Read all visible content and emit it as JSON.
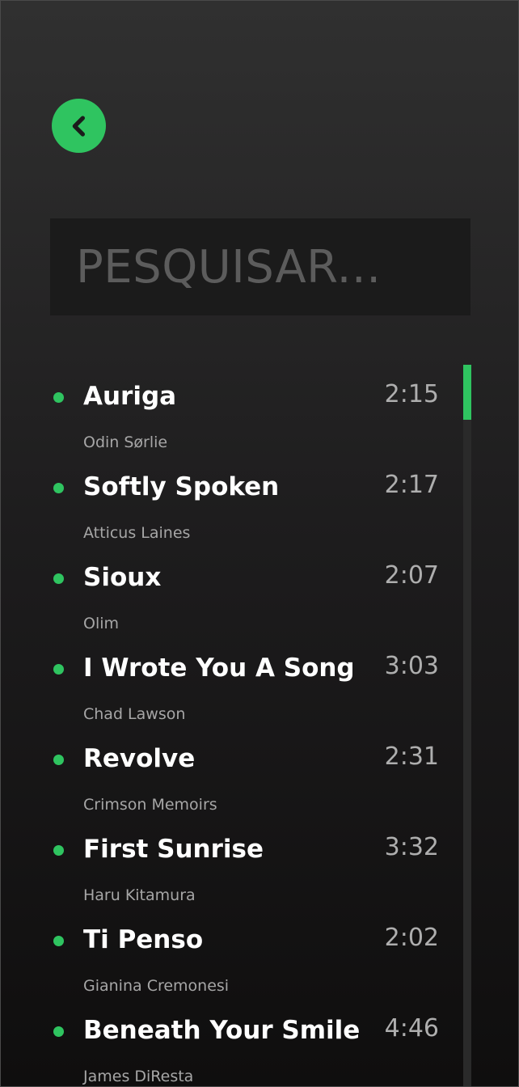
{
  "back_button": {
    "icon": "chevron-left-icon",
    "accent": "#2fc460"
  },
  "search": {
    "placeholder": "PESQUISAR...",
    "value": ""
  },
  "tracks": [
    {
      "title": "Auriga",
      "artist": "Odin Sørlie",
      "duration": "2:15"
    },
    {
      "title": "Softly Spoken",
      "artist": "Atticus Laines",
      "duration": "2:17"
    },
    {
      "title": "Sioux",
      "artist": "Olim",
      "duration": "2:07"
    },
    {
      "title": "I Wrote You A Song",
      "artist": "Chad Lawson",
      "duration": "3:03"
    },
    {
      "title": "Revolve",
      "artist": "Crimson Memoirs",
      "duration": "2:31"
    },
    {
      "title": "First Sunrise",
      "artist": "Haru Kitamura",
      "duration": "3:32"
    },
    {
      "title": "Ti Penso",
      "artist": "Gianina Cremonesi",
      "duration": "2:02"
    },
    {
      "title": "Beneath Your Smile",
      "artist": "James DiResta",
      "duration": "4:46"
    }
  ],
  "colors": {
    "accent": "#2fc460",
    "background_top": "#303030",
    "background_bottom": "#0f0e0e"
  }
}
